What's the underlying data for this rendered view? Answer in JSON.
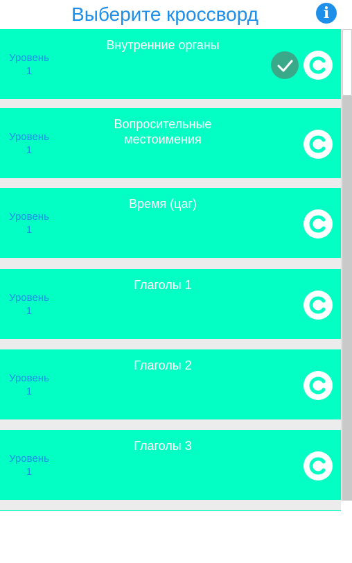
{
  "header": {
    "title": "Выберите кроссворд",
    "info_icon": "info-icon"
  },
  "crosswords": [
    {
      "name": "Внутренние органы",
      "level": "Уровень\n1",
      "completed": true
    },
    {
      "name": "Вопросительные местоимения",
      "level": "Уровень\n1",
      "completed": false
    },
    {
      "name": "Время (цаг)",
      "level": "Уровень\n1",
      "completed": false
    },
    {
      "name": "Глаголы 1",
      "level": "Уровень\n1",
      "completed": false
    },
    {
      "name": "Глаголы 2",
      "level": "Уровень\n1",
      "completed": false
    },
    {
      "name": "Глаголы 3",
      "level": "Уровень\n1",
      "completed": false
    }
  ],
  "colors": {
    "accent": "#1e8fe8",
    "item_bg": "#03ffc4",
    "check_bg": "#3aa98a"
  }
}
